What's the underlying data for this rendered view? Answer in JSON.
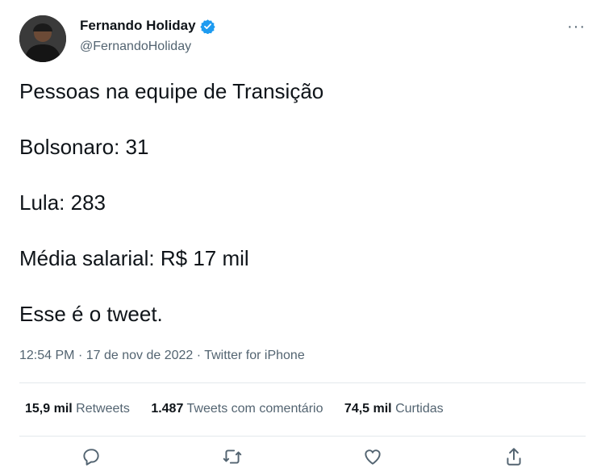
{
  "author": {
    "display_name": "Fernando Holiday",
    "handle": "@FernandoHoliday"
  },
  "tweet_lines": [
    "Pessoas na equipe de Transição",
    "Bolsonaro: 31",
    "Lula: 283",
    "Média salarial: R$ 17 mil",
    "Esse é o tweet."
  ],
  "meta": {
    "time": "12:54 PM",
    "sep": "·",
    "date": "17 de nov de 2022",
    "source": "Twitter for iPhone"
  },
  "stats": {
    "retweets": {
      "count": "15,9 mil",
      "label": "Retweets"
    },
    "quotes": {
      "count": "1.487",
      "label": "Tweets com comentário"
    },
    "likes": {
      "count": "74,5 mil",
      "label": "Curtidas"
    }
  },
  "icons": {
    "more": "more-horizontal-icon",
    "verified": "verified-badge-icon",
    "reply": "reply-icon",
    "retweet": "retweet-icon",
    "like": "like-icon",
    "share": "share-icon"
  },
  "colors": {
    "verified": "#1d9bf0",
    "text": "#0f1419",
    "muted": "#536471"
  }
}
